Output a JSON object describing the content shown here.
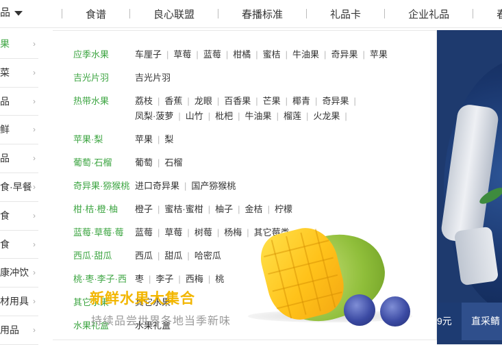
{
  "nav": {
    "category_label": "品",
    "links": [
      "食谱",
      "良心联盟",
      "春播标准",
      "礼品卡",
      "企业礼品",
      "春"
    ]
  },
  "sidebar": {
    "items": [
      {
        "label": "果"
      },
      {
        "label": "菜"
      },
      {
        "label": "品"
      },
      {
        "label": "鲜"
      },
      {
        "label": "品"
      },
      {
        "label": "食·早餐"
      },
      {
        "label": "食"
      },
      {
        "label": "食"
      },
      {
        "label": "康冲饮"
      },
      {
        "label": "材用具"
      },
      {
        "label": "用品"
      }
    ]
  },
  "dropdown": {
    "rows": [
      {
        "category": "应季水果",
        "items": [
          "车厘子",
          "草莓",
          "蓝莓",
          "柑橘",
          "蜜桔",
          "牛油果",
          "奇异果",
          "苹果"
        ]
      },
      {
        "category": "吉光片羽",
        "items": [
          "吉光片羽"
        ]
      },
      {
        "category": "热带水果",
        "items": [
          "荔枝",
          "香蕉",
          "龙眼",
          "百香果",
          "芒果",
          "椰青",
          "奇异果",
          "凤梨·菠萝",
          "山竹",
          "枇杷",
          "牛油果",
          "榴莲",
          "火龙果"
        ]
      },
      {
        "category": "苹果·梨",
        "items": [
          "苹果",
          "梨"
        ]
      },
      {
        "category": "葡萄·石榴",
        "items": [
          "葡萄",
          "石榴"
        ]
      },
      {
        "category": "奇异果·猕猴桃",
        "items": [
          "进口奇异果",
          "国产猕猴桃"
        ]
      },
      {
        "category": "柑·桔·橙·柚",
        "items": [
          "橙子",
          "蜜桔·蜜柑",
          "柚子",
          "金桔",
          "柠檬"
        ]
      },
      {
        "category": "蓝莓·草莓·莓",
        "items": [
          "蓝莓",
          "草莓",
          "树莓",
          "杨梅",
          "其它莓类"
        ]
      },
      {
        "category": "西瓜·甜瓜",
        "items": [
          "西瓜",
          "甜瓜",
          "哈密瓜"
        ]
      },
      {
        "category": "桃·枣·李子·西",
        "items": [
          "枣",
          "李子",
          "西梅",
          "桃"
        ]
      },
      {
        "category": "其它水果",
        "items": [
          "其它水果"
        ]
      },
      {
        "category": "水果礼盒",
        "items": [
          "水果礼盒"
        ]
      }
    ]
  },
  "promo": {
    "title": "新鲜水果大集合",
    "subtitle": "持续品尝世界各地当季新味"
  },
  "banner": {
    "price": "9元",
    "tag": "直采鲭"
  }
}
